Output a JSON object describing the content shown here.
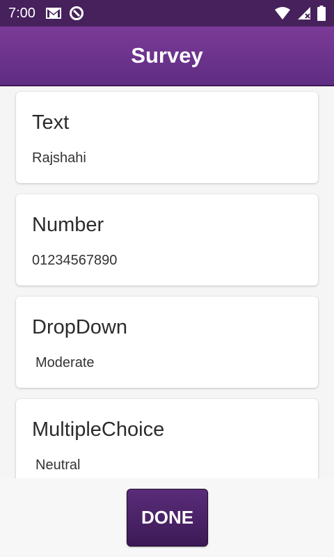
{
  "status_bar": {
    "time": "7:00",
    "icons": [
      "gmail-icon",
      "sync-icon",
      "wifi-icon",
      "signal-icon",
      "battery-icon"
    ]
  },
  "app_bar": {
    "title": "Survey"
  },
  "cards": [
    {
      "title": "Text",
      "value": "Rajshahi"
    },
    {
      "title": "Number",
      "value": "01234567890"
    },
    {
      "title": "DropDown",
      "value": "Moderate"
    },
    {
      "title": "MultipleChoice",
      "value": "Neutral"
    }
  ],
  "footer": {
    "done_label": "DONE"
  },
  "colors": {
    "status_bar": "#46215c",
    "app_bar": "#6a318c",
    "button": "#4a2266"
  }
}
